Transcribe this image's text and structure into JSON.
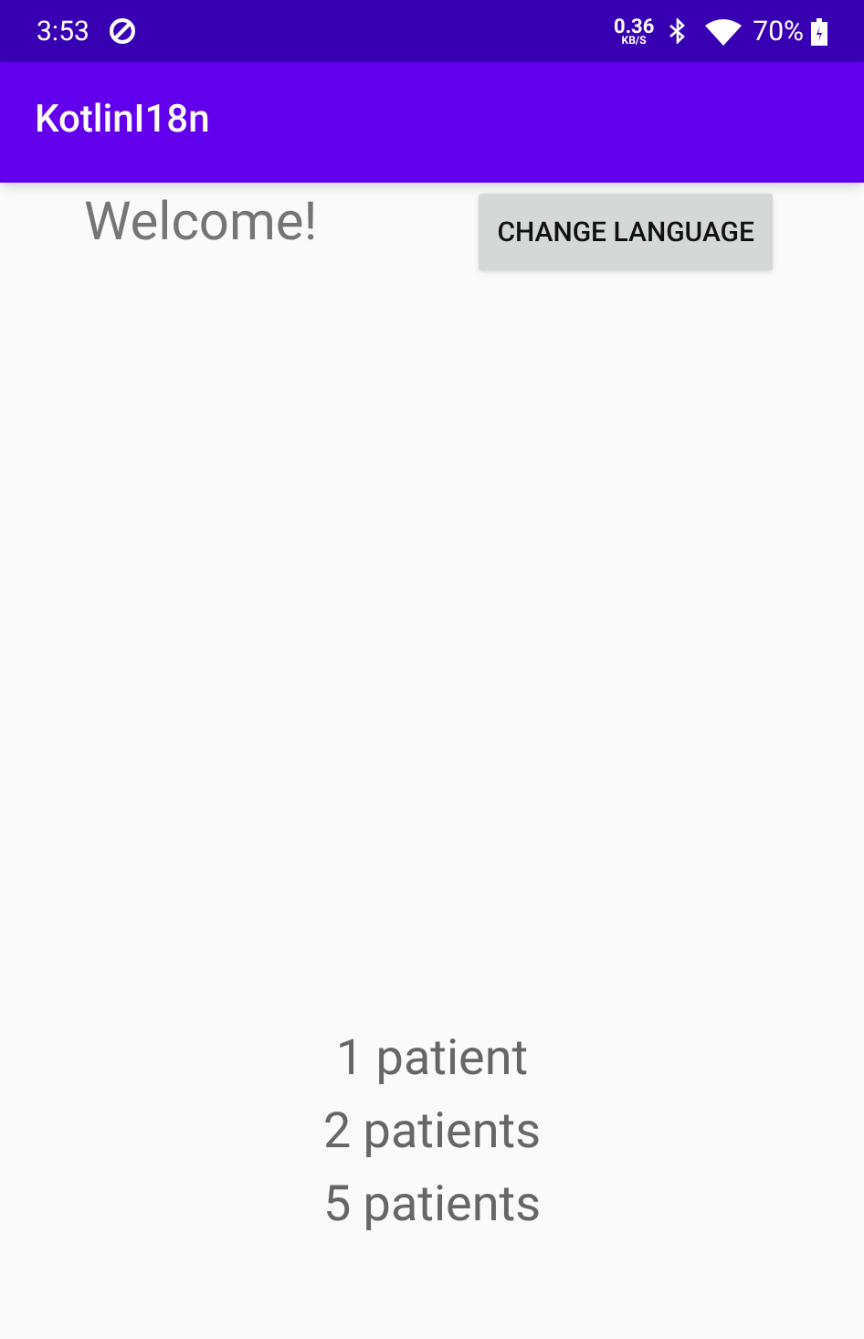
{
  "status_bar": {
    "time": "3:53",
    "speed_value": "0.36",
    "speed_unit": "KB/S",
    "battery": "70%"
  },
  "app_bar": {
    "title": "KotlinI18n"
  },
  "greeting": "Welcome!",
  "change_language_button": "CHANGE LANGUAGE",
  "counts": [
    "1 patient",
    "2 patients",
    "5 patients"
  ]
}
